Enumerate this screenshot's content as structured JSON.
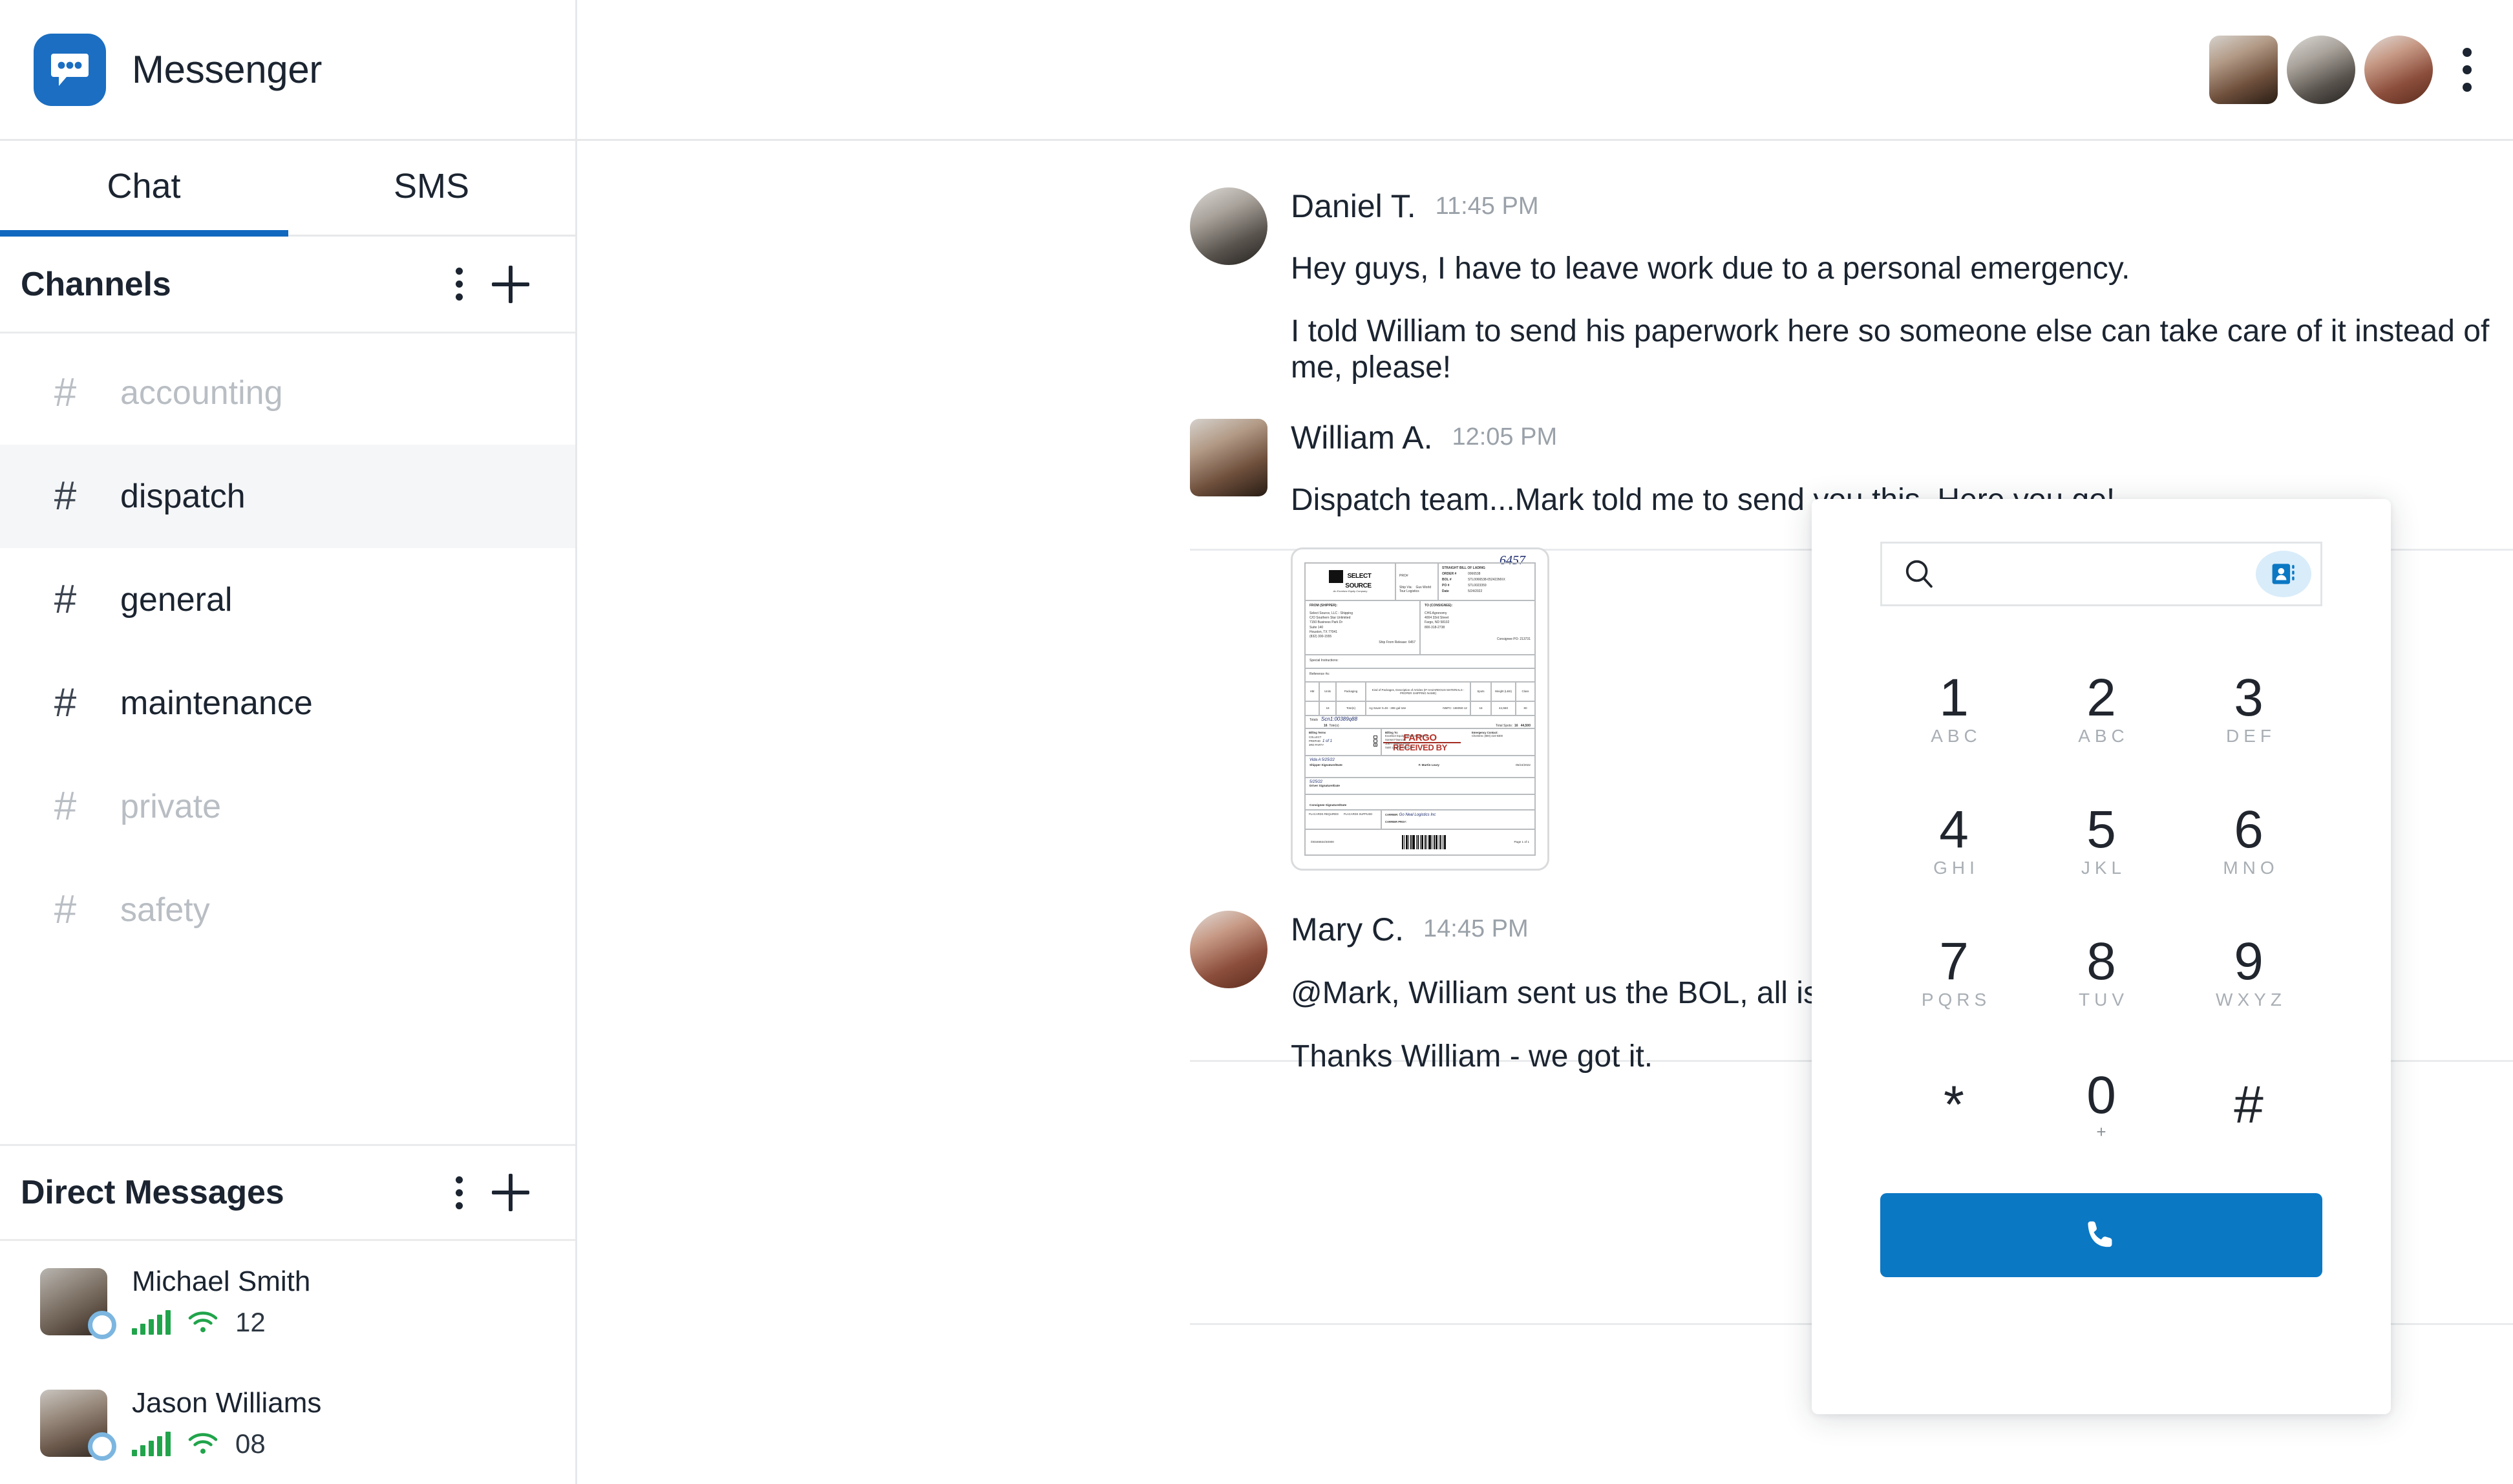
{
  "app": {
    "title": "Messenger",
    "logo_icon": "chat-bubble-icon",
    "accent_color": "#1b6ec2",
    "call_button_color": "#0b78c4",
    "status_online_color": "#21a44b"
  },
  "tabs": [
    {
      "label": "Chat",
      "active": true
    },
    {
      "label": "SMS",
      "active": false
    }
  ],
  "channels_section": {
    "title": "Channels",
    "more_icon": "kebab-menu-icon",
    "add_icon": "plus-icon",
    "items": [
      {
        "hash": "#",
        "name": "accounting",
        "muted": true,
        "active": false
      },
      {
        "hash": "#",
        "name": "dispatch",
        "muted": false,
        "active": true
      },
      {
        "hash": "#",
        "name": "general",
        "muted": false,
        "active": false
      },
      {
        "hash": "#",
        "name": "maintenance",
        "muted": false,
        "active": false
      },
      {
        "hash": "#",
        "name": "private",
        "muted": true,
        "active": false
      },
      {
        "hash": "#",
        "name": "safety",
        "muted": true,
        "active": false
      }
    ]
  },
  "direct_messages_section": {
    "title": "Direct Messages",
    "more_icon": "kebab-menu-icon",
    "add_icon": "plus-icon",
    "items": [
      {
        "name": "Michael Smith",
        "count": "12",
        "signal_icon": "signal-bars-icon",
        "wifi_icon": "wifi-icon",
        "presence": "away"
      },
      {
        "name": "Jason Williams",
        "count": "08",
        "signal_icon": "signal-bars-icon",
        "wifi_icon": "wifi-icon",
        "presence": "away"
      }
    ]
  },
  "topbar": {
    "participants": [
      {
        "name": "William A."
      },
      {
        "name": "Daniel T."
      },
      {
        "name": "Mary C."
      }
    ],
    "more_icon": "kebab-menu-icon"
  },
  "thread": {
    "messages": [
      {
        "author": "Daniel T.",
        "time": "11:45 PM",
        "avatar_shape": "circle",
        "lines": [
          "Hey guys, I have to leave work due to a personal emergency.",
          "I told William to send his paperwork here so someone else can take care of it instead of me, please!"
        ],
        "attachment": null
      },
      {
        "author": "William A.",
        "time": "12:05 PM",
        "avatar_shape": "square",
        "lines": [
          "Dispatch team...Mark told me to send you this.  Here you go!"
        ],
        "attachment": "bill-of-lading-thumbnail"
      },
      {
        "author": "Mary C.",
        "time": "14:45 PM",
        "avatar_shape": "circle",
        "lines": [
          "@Mark, William sent us the BOL, all is good on our side.",
          "Thanks William - we got it."
        ],
        "attachment": null
      }
    ]
  },
  "attachment_document": {
    "handwritten_number": "6457",
    "company_name_line1": "SELECT",
    "company_name_line2": "SOURCE",
    "company_tagline": "An Excelsior Equity Company",
    "pro_label": "PRO#",
    "shipvia_label": "Ship Via:",
    "shipvia_value": "Gus World Tour Logistics",
    "doc_title": "STRAIGHT BILL OF LADING",
    "order_label": "ORDER #",
    "order_value": "0066538",
    "bol_label": "BOL #",
    "bol_value": "STL0066538-052422MXX",
    "po_label": "PO #",
    "po_value": "STL0023359",
    "date_label": "Date",
    "date_value": "5/24/2022",
    "from_title": "FROM (SHIPPER):",
    "from_lines": [
      "Select Source, LLC - Shipping",
      "C/O Southern Star Unlimited",
      "7150 Business Park Dr",
      "Suite 140",
      "Houston, TX 77041",
      "(832) 300-1555"
    ],
    "to_title": "TO (CONSIGNEE):",
    "to_lines": [
      "CHS Agronomy",
      "4004 33rd Street",
      "Fargo, ND 58102",
      "800-318-2738"
    ],
    "ship_from_release": "Ship From Release:  6457",
    "consignee_po": "Consignee PO:  213731",
    "special_instructions": "Special Instructions:",
    "reference_nos": "Reference #s:",
    "table_headers": [
      "HM",
      "Units",
      "Packaging",
      "Kind of Packages, Description of Articles (IF HAZARDOUS MATERIALS - PROPER SHIPPING NAME)",
      "Spots",
      "Weight (LBS)",
      "Class"
    ],
    "table_row": [
      "",
      "16",
      "Tote(s)",
      "Ag Saver 5.48 - 265 gal tote",
      "16",
      "44,550",
      "60"
    ],
    "nmfc": "NMFC: 156050-12",
    "totals_label": "Totals",
    "totals_units": "16",
    "totals_units_label": "Tote(s)",
    "total_spots_label": "Total Spots:",
    "total_spots": "16",
    "total_weight": "44,500",
    "stamp_line1": "FARGO",
    "stamp_line2": "RECEIVED BY",
    "handwritten_scan": "Scn1:00389q88",
    "handwritten_of": "1 of 1",
    "billing_terms_label": "Billing Terms",
    "billing_terms_options": [
      "COLLECT",
      "PREPAID",
      "3RD PARTY"
    ],
    "billing_to_label": "Billing To:",
    "billing_to_lines": [
      "Excelsior Equity (Select Source) c/o",
      "Sunset Financial",
      "10877 Watson Road",
      "Saint Louis, MO 63127"
    ],
    "emergency_contact_label": "Emergency Contact:",
    "emergency_contact_value": "Chemtrec (800) 424-9300",
    "shipper_sig_label": "Shipper Signature/Date",
    "shipper_sig_hand": "Vida A  5/25/22",
    "driver_sig_label": "Driver Signature/Date",
    "driver_sig_hand": "5/25/22",
    "consignee_sig_label": "Consignee Signature/Date",
    "martin_leary": "F. Martin Leary",
    "martin_date": "05/24/2022",
    "placards_required": "PLACARDS REQUIRED",
    "placards_supplied": "PLACARDS SUPPLIED",
    "freight_counted": "Freight Counted:",
    "freight_options": [
      "By Shipper",
      "By Driver/pallets said to contain",
      "By Driver/pieces"
    ],
    "carrier_label": "CARRIER:",
    "carrier_value": "Go Neal Logistics Inc",
    "carrier_pro_label": "CARRIER PRO#:",
    "footer_code": "/00346924/40000",
    "page_label": "Page 1 of 1"
  },
  "dialpad": {
    "search_value": "",
    "search_placeholder": "",
    "search_icon": "search-icon",
    "contacts_icon": "contact-card-icon",
    "call_icon": "phone-icon",
    "keys": [
      {
        "digit": "1",
        "letters": "ABC"
      },
      {
        "digit": "2",
        "letters": "ABC"
      },
      {
        "digit": "3",
        "letters": "DEF"
      },
      {
        "digit": "4",
        "letters": "GHI"
      },
      {
        "digit": "5",
        "letters": "JKL"
      },
      {
        "digit": "6",
        "letters": "MNO"
      },
      {
        "digit": "7",
        "letters": "PQRS"
      },
      {
        "digit": "8",
        "letters": "TUV"
      },
      {
        "digit": "9",
        "letters": "WXYZ"
      },
      {
        "digit": "*",
        "letters": ""
      },
      {
        "digit": "0",
        "letters": "",
        "sub": "+"
      },
      {
        "digit": "#",
        "letters": ""
      }
    ]
  }
}
